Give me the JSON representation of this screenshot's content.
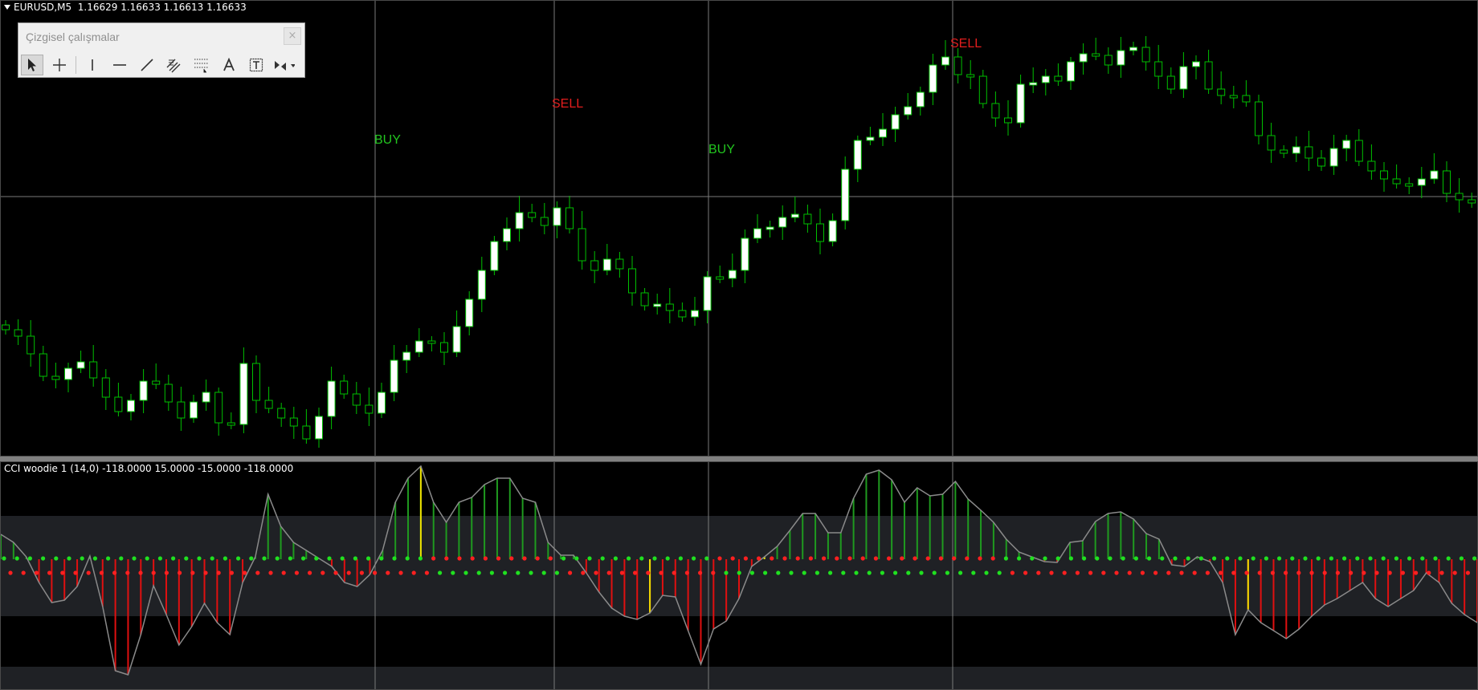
{
  "chart": {
    "symbol_label": "EURUSD,M5",
    "quotes": "1.16629 1.16633 1.16613 1.16633",
    "header_text": "EURUSD,M5  1.16629 1.16633 1.16613 1.16633"
  },
  "indicator": {
    "header_text": "CCI woodie 1 (14,0) -118.0000 15.0000 -15.0000 -118.0000",
    "levels": [
      118,
      15,
      -15,
      -118
    ]
  },
  "signals": [
    {
      "label": "BUY",
      "kind": "buy"
    },
    {
      "label": "SELL",
      "kind": "sell"
    },
    {
      "label": "BUY",
      "kind": "buy"
    },
    {
      "label": "SELL",
      "kind": "sell"
    }
  ],
  "toolbar": {
    "title": "Çizgisel çalışmalar",
    "close_glyph": "×",
    "tools": [
      {
        "name": "cursor-icon"
      },
      {
        "name": "crosshair-icon"
      },
      {
        "name": "vertical-line-icon"
      },
      {
        "name": "horizontal-line-icon"
      },
      {
        "name": "trendline-icon"
      },
      {
        "name": "equidistant-channel-icon"
      },
      {
        "name": "fibonacci-icon"
      },
      {
        "name": "text-icon"
      },
      {
        "name": "text-label-icon"
      },
      {
        "name": "arrows-dropdown-icon"
      }
    ]
  },
  "colors": {
    "background": "#000000",
    "bull_candle": "#ffffff",
    "candle_wick": "#00c000",
    "buy_signal": "#22c41f",
    "sell_signal": "#e21d1d",
    "cci_line": "#8a8a8a",
    "hist_green": "#1f9a1f",
    "hist_red": "#e01010",
    "hist_yellow": "#f0e000",
    "grid_line": "#7a7a7a",
    "level_band": "#1f2125"
  }
}
